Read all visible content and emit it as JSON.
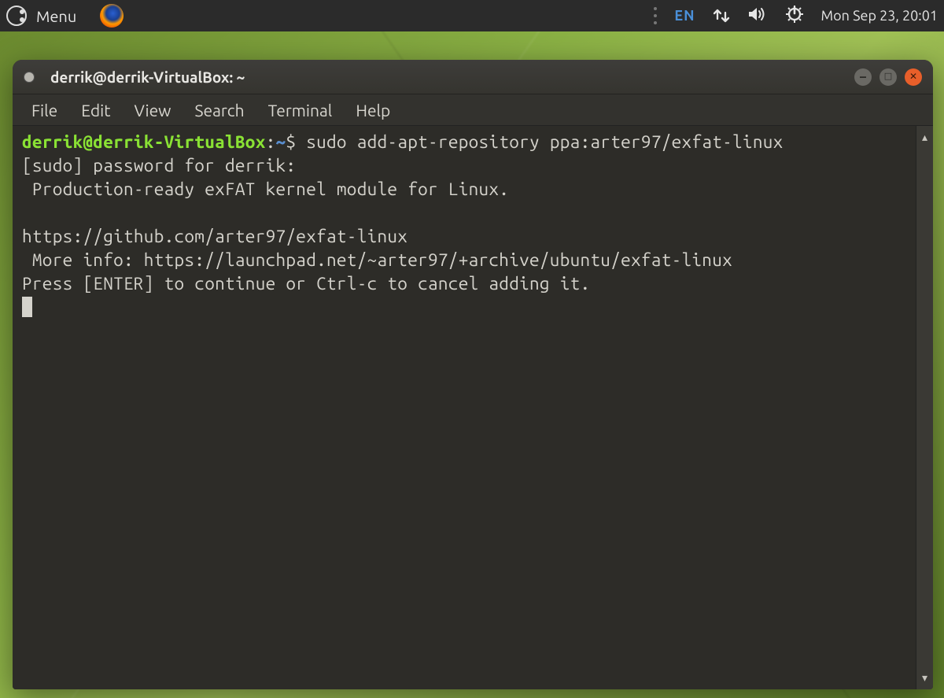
{
  "panel": {
    "menu_label": "Menu",
    "language": "EN",
    "clock": "Mon Sep 23, 20:01"
  },
  "window": {
    "title": "derrik@derrik-VirtualBox: ~",
    "menus": {
      "file": "File",
      "edit": "Edit",
      "view": "View",
      "search": "Search",
      "terminal": "Terminal",
      "help": "Help"
    }
  },
  "terminal": {
    "prompt_user_host": "derrik@derrik-VirtualBox",
    "prompt_sep": ":",
    "prompt_path": "~",
    "prompt_symbol": "$ ",
    "command": "sudo add-apt-repository ppa:arter97/exfat-linux",
    "lines": {
      "l2": "[sudo] password for derrik:",
      "l3": " Production-ready exFAT kernel module for Linux.",
      "l4": "",
      "l5": "https://github.com/arter97/exfat-linux",
      "l6": " More info: https://launchpad.net/~arter97/+archive/ubuntu/exfat-linux",
      "l7": "Press [ENTER] to continue or Ctrl-c to cancel adding it."
    }
  }
}
